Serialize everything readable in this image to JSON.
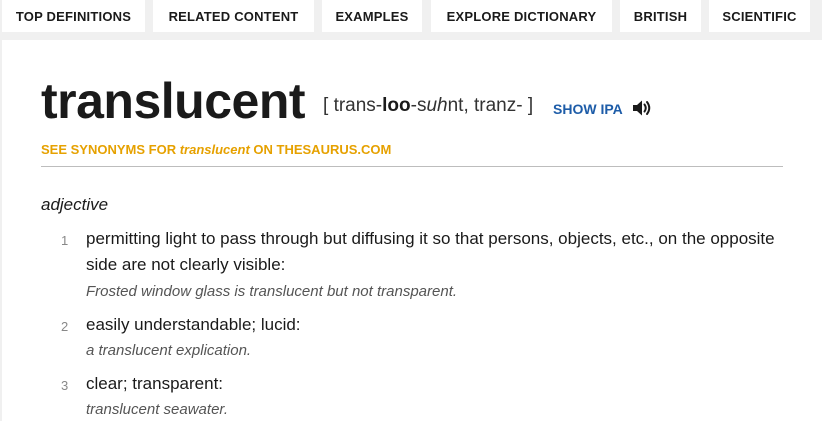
{
  "nav": {
    "tabs": [
      {
        "label": "TOP DEFINITIONS"
      },
      {
        "label": "RELATED CONTENT"
      },
      {
        "label": "EXAMPLES"
      },
      {
        "label": "EXPLORE DICTIONARY"
      },
      {
        "label": "BRITISH"
      },
      {
        "label": "SCIENTIFIC"
      }
    ]
  },
  "entry": {
    "word": "translucent",
    "pron_open": "[ ",
    "pron_1": "trans-",
    "pron_stress": "loo",
    "pron_2": "-s",
    "pron_uh": "uh",
    "pron_3": "nt, tranz- ",
    "pron_close": "]",
    "show_ipa": "SHOW IPA",
    "audio_icon": "speaker-icon",
    "synonyms": {
      "prefix": "SEE SYNONYMS FOR ",
      "word": "translucent",
      "suffix": " ON THESAURUS.COM"
    },
    "part_of_speech": "adjective",
    "definitions": [
      {
        "num": "1",
        "text": "permitting light to pass through but diffusing it so that persons, objects, etc., on the opposite side are not clearly visible:",
        "example": "Frosted window glass is translucent but not transparent."
      },
      {
        "num": "2",
        "text": "easily understandable; lucid:",
        "example": "a translucent explication."
      },
      {
        "num": "3",
        "text": "clear; transparent:",
        "example": "translucent seawater."
      }
    ]
  },
  "colors": {
    "accent_link": "#1d5ca8",
    "synonym_link": "#e6a100"
  }
}
